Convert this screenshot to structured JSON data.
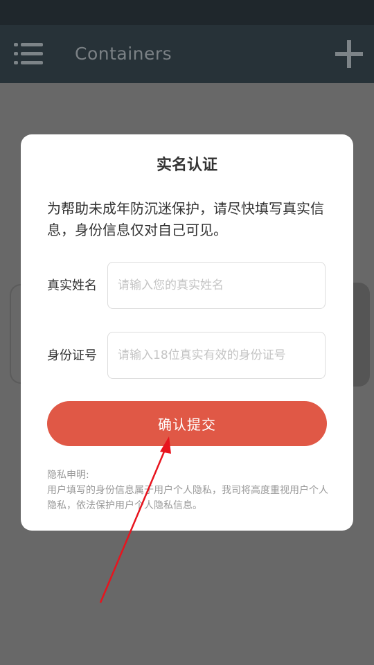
{
  "app_bar": {
    "title": "Containers",
    "menu_icon": "menu-list-icon",
    "add_icon": "plus-icon"
  },
  "dialog": {
    "title": "实名认证",
    "description": "为帮助未成年防沉迷保护，请尽快填写真实信息，身份信息仅对自己可见。",
    "fields": [
      {
        "label": "真实姓名",
        "value": "",
        "placeholder": "请输入您的真实姓名"
      },
      {
        "label": "身份证号",
        "value": "",
        "placeholder": "请输入18位真实有效的身份证号"
      }
    ],
    "submit_label": "确认提交",
    "privacy_title": "隐私申明:",
    "privacy_text": "用户填写的身份信息属于用户个人隐私，我司将高度重视用户个人隐私，依法保护用户个人隐私信息。"
  },
  "colors": {
    "status_bar": "#1f272c",
    "app_bar": "#273238",
    "overlay": "#686868",
    "accent": "#e05846",
    "annotation_arrow": "#e8141e"
  }
}
